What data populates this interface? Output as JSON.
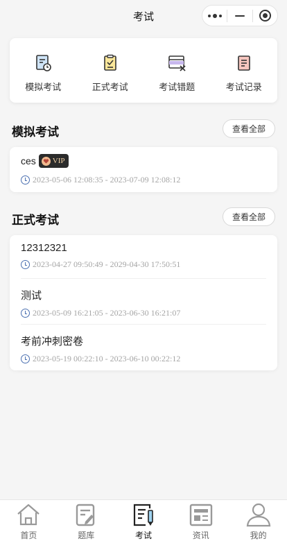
{
  "header": {
    "title": "考试"
  },
  "quick_menu": [
    {
      "label": "模拟考试",
      "icon": "mock-exam-icon"
    },
    {
      "label": "正式考试",
      "icon": "formal-exam-icon"
    },
    {
      "label": "考试错题",
      "icon": "wrong-questions-icon"
    },
    {
      "label": "考试记录",
      "icon": "exam-record-icon"
    }
  ],
  "mock_section": {
    "title": "模拟考试",
    "view_all": "查看全部",
    "items": [
      {
        "name": "ces",
        "badge": "VIP",
        "time": "2023-05-06 12:08:35 - 2023-07-09 12:08:12"
      }
    ]
  },
  "formal_section": {
    "title": "正式考试",
    "view_all": "查看全部",
    "items": [
      {
        "name": "12312321",
        "time": "2023-04-27 09:50:49 - 2029-04-30 17:50:51"
      },
      {
        "name": "测试",
        "time": "2023-05-09 16:21:05 - 2023-06-30 16:21:07"
      },
      {
        "name": "考前冲刺密卷",
        "time": "2023-05-19 00:22:10 - 2023-06-10 00:22:12"
      }
    ]
  },
  "tabbar": {
    "active": "exam",
    "items": [
      {
        "label": "首页",
        "icon": "home-icon"
      },
      {
        "label": "题库",
        "icon": "question-bank-icon"
      },
      {
        "label": "考试",
        "icon": "exam-icon"
      },
      {
        "label": "资讯",
        "icon": "news-icon"
      },
      {
        "label": "我的",
        "icon": "profile-icon"
      }
    ]
  },
  "colors": {
    "accent": "#4a6fb0",
    "background": "#f5f5f5",
    "vip_bg": "#2b2b2b",
    "vip_text": "#f2d3a8"
  }
}
